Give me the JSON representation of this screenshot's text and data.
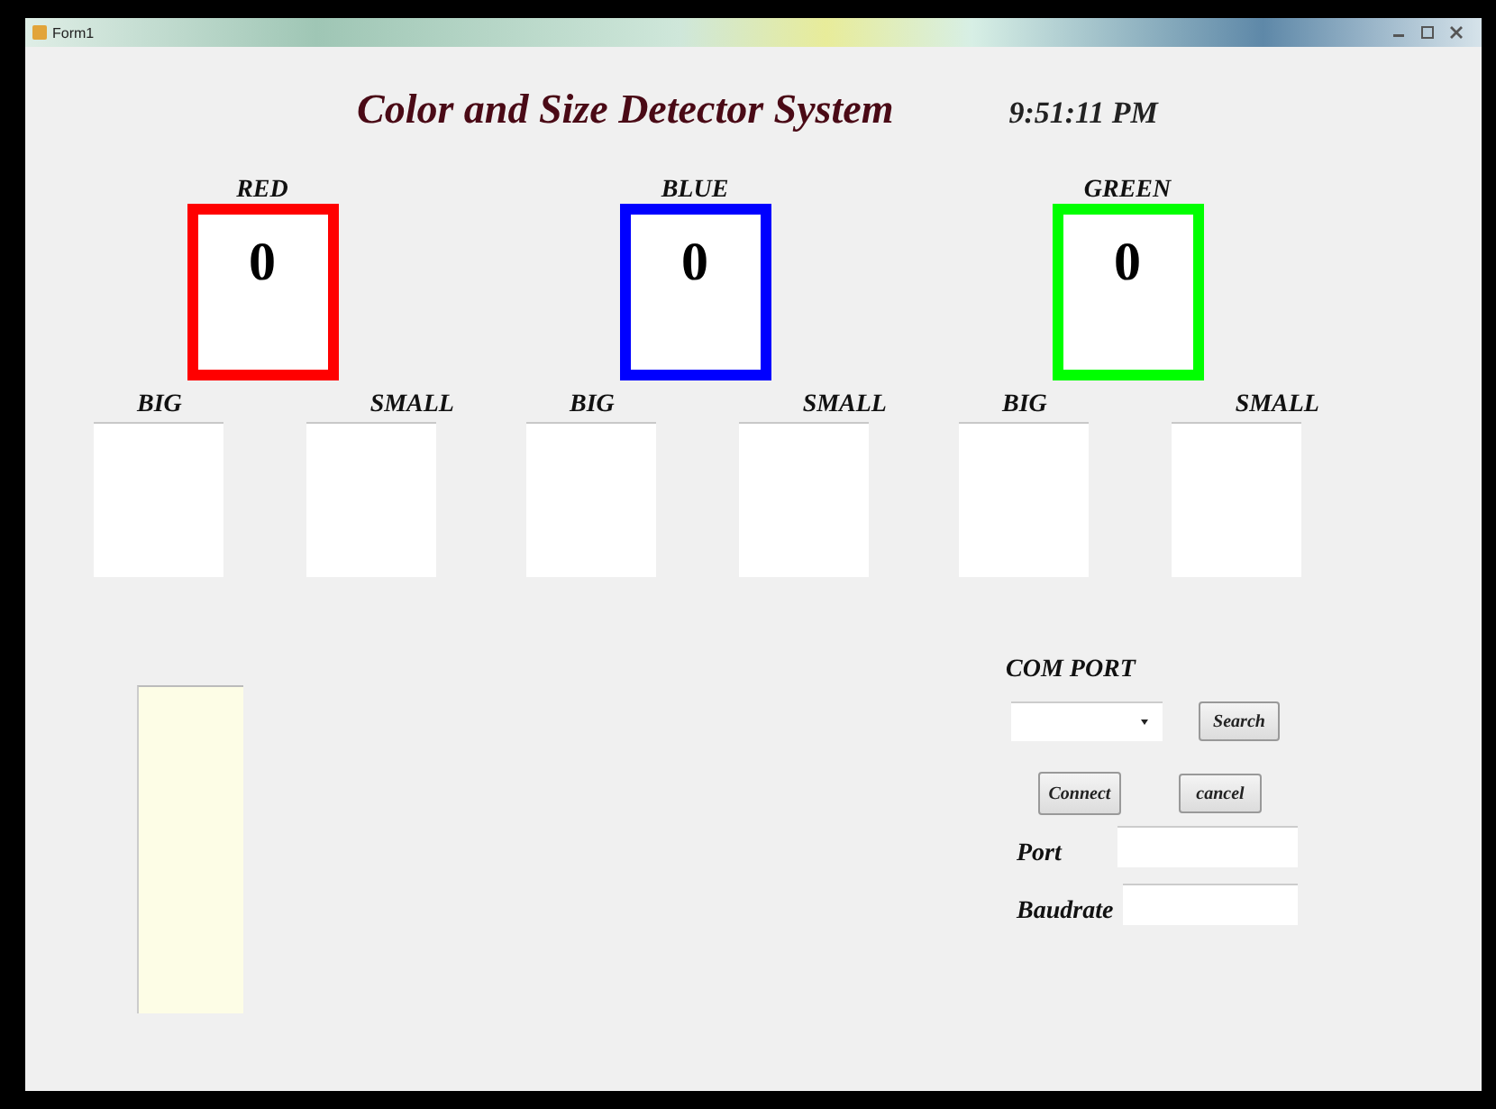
{
  "window": {
    "title": "Form1"
  },
  "header": {
    "title": "Color and Size Detector System",
    "time": "9:51:11 PM"
  },
  "colors": [
    {
      "name": "RED",
      "color": "#ff0000",
      "count": "0",
      "big_label": "BIG",
      "small_label": "SMALL"
    },
    {
      "name": "BLUE",
      "color": "#0000ff",
      "count": "0",
      "big_label": "BIG",
      "small_label": "SMALL"
    },
    {
      "name": "GREEN",
      "color": "#00ff00",
      "count": "0",
      "big_label": "BIG",
      "small_label": "SMALL"
    }
  ],
  "com_panel": {
    "title": "COM PORT",
    "search_button": "Search",
    "connect_button": "Connect",
    "cancel_button": "cancel",
    "port_label": "Port",
    "baudrate_label": "Baudrate"
  }
}
